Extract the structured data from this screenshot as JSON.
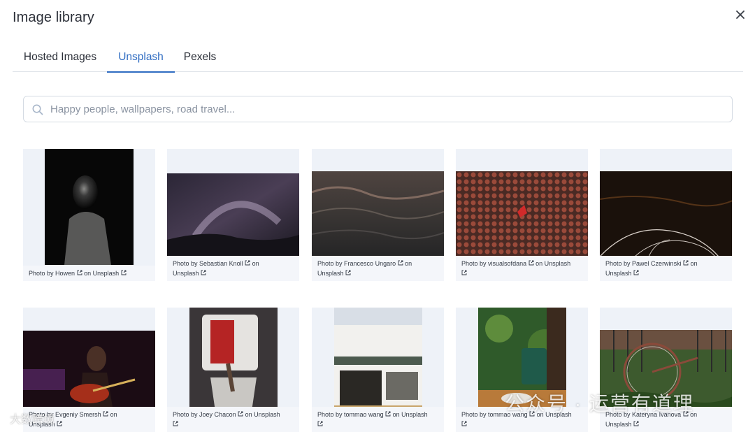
{
  "dialog": {
    "title": "Image library",
    "close_icon": "close-icon"
  },
  "tabs": [
    {
      "label": "Hosted Images",
      "active": false
    },
    {
      "label": "Unsplash",
      "active": true
    },
    {
      "label": "Pexels",
      "active": false
    }
  ],
  "search": {
    "placeholder": "Happy people, wallpapers, road travel...",
    "value": "",
    "icon": "search-icon"
  },
  "colors": {
    "accent": "#2f6cc2",
    "card_bg": "#eef2f8",
    "divider": "#dfe3e9"
  },
  "photos": [
    {
      "photographer": "Howen",
      "prefix": "Photo by",
      "on": "on",
      "source": "Unsplash",
      "subject": "portrait in dark"
    },
    {
      "photographer": "Sebastian Knoll",
      "prefix": "Photo by",
      "on": "on",
      "source": "Unsplash",
      "subject": "milky way night sky"
    },
    {
      "photographer": "Francesco Ungaro",
      "prefix": "Photo by",
      "on": "on",
      "source": "Unsplash",
      "subject": "ocean waves"
    },
    {
      "photographer": "visualsofdana",
      "prefix": "Photo by",
      "on": "on",
      "source": "Unsplash",
      "subject": "red leaves"
    },
    {
      "photographer": "Pawel Czerwinski",
      "prefix": "Photo by",
      "on": "on",
      "source": "Unsplash",
      "subject": "light streaks"
    },
    {
      "photographer": "Evgeniy Smersh",
      "prefix": "Photo by",
      "on": "on",
      "source": "Unsplash",
      "subject": "guitarist on stage"
    },
    {
      "photographer": "Joey Chacon",
      "prefix": "Photo by",
      "on": "on",
      "source": "Unsplash",
      "subject": "coffee roaster"
    },
    {
      "photographer": "tommao wang",
      "prefix": "Photo by",
      "on": "on",
      "source": "Unsplash",
      "subject": "coffee shop storefront"
    },
    {
      "photographer": "tommao wang",
      "prefix": "Photo by",
      "on": "on",
      "source": "Unsplash",
      "subject": "coffee cup by window"
    },
    {
      "photographer": "Kateryna Ivanova",
      "prefix": "Photo by",
      "on": "on",
      "source": "Unsplash",
      "subject": "bicycle by fence"
    }
  ],
  "watermark": {
    "text": "公众号 · 运营有道理",
    "small": "大数跨境"
  }
}
